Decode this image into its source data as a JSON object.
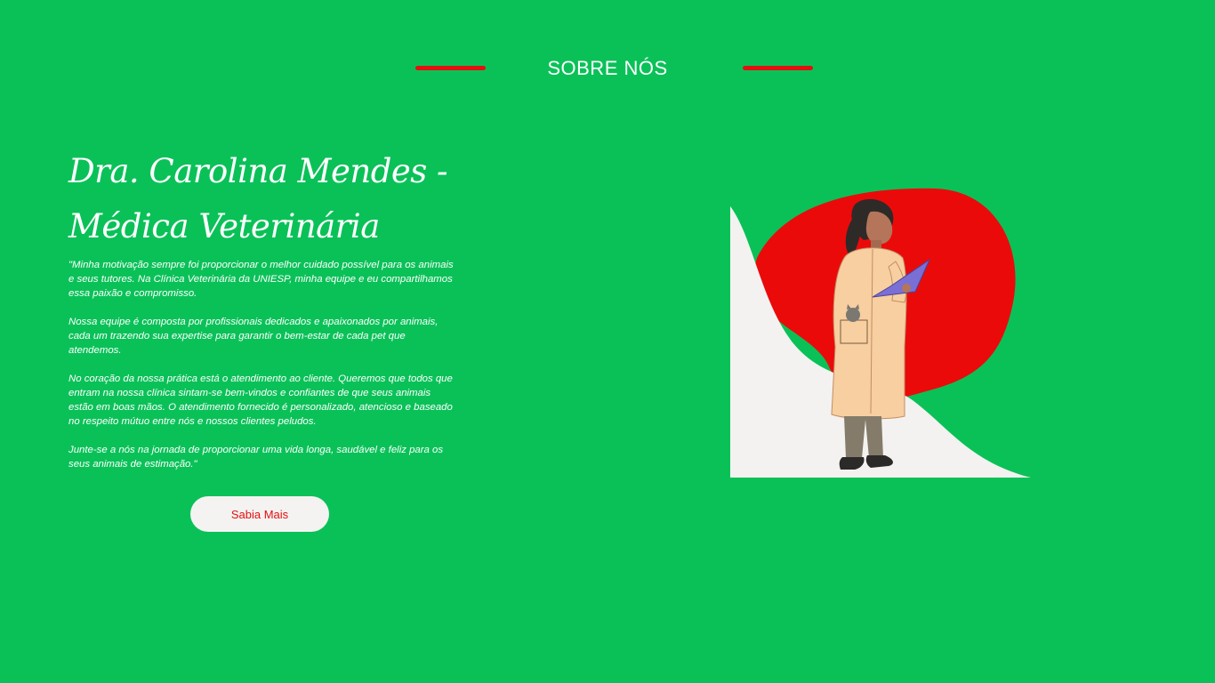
{
  "header": {
    "title": "SOBRE NÓS"
  },
  "about": {
    "name_line1": "Dra. Carolina Mendes -",
    "name_line2": "Médica Veterinária",
    "paragraphs": [
      "\"Minha motivação sempre foi proporcionar o melhor cuidado possível para os animais e seus tutores. Na Clínica Veterinária da UNIESP, minha equipe e eu compartilhamos essa paixão e compromisso.",
      "Nossa equipe é composta por profissionais dedicados e apaixonados por animais, cada um trazendo sua expertise para garantir o bem-estar de cada pet que atendemos.",
      "No coração da nossa prática está o atendimento ao cliente. Queremos que todos que entram na nossa clínica sintam-se bem-vindos e confiantes de que seus animais estão em boas mãos. O atendimento fornecido é personalizado, atencioso e baseado no respeito mútuo entre nós e nossos clientes peludos.",
      "Junte-se a nós na jornada de proporcionar uma vida longa, saudável e feliz para os seus animais de estimação.\""
    ],
    "button_label": "Sabia Mais"
  },
  "illustration": {
    "icon": "veterinarian-with-clipboard-illustration"
  },
  "colors": {
    "background": "#0ac158",
    "accent": "#e3100f",
    "light": "#f4f3f2"
  }
}
